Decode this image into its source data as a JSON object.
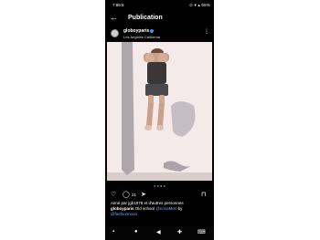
{
  "status_bar": {
    "time": "7:86:5",
    "icons": "⊙ ▾ ▴ 65%"
  },
  "header": {
    "back_icon": "arrow-left-icon",
    "title": "Publication"
  },
  "post": {
    "username": "globoyparis",
    "location": "Los Angeles California",
    "likes_count": "21",
    "liked_by": "Aimé par jgb1978 et d'autres personnes",
    "caption_user": "globoyparis",
    "caption_text": "Old school",
    "caption_mention1": "@novaMen",
    "caption_by": "by",
    "caption_mention2": "@fashionnova"
  },
  "colors": {
    "accent": "#3897f0",
    "background": "#000000",
    "link": "#6aa8ff"
  }
}
